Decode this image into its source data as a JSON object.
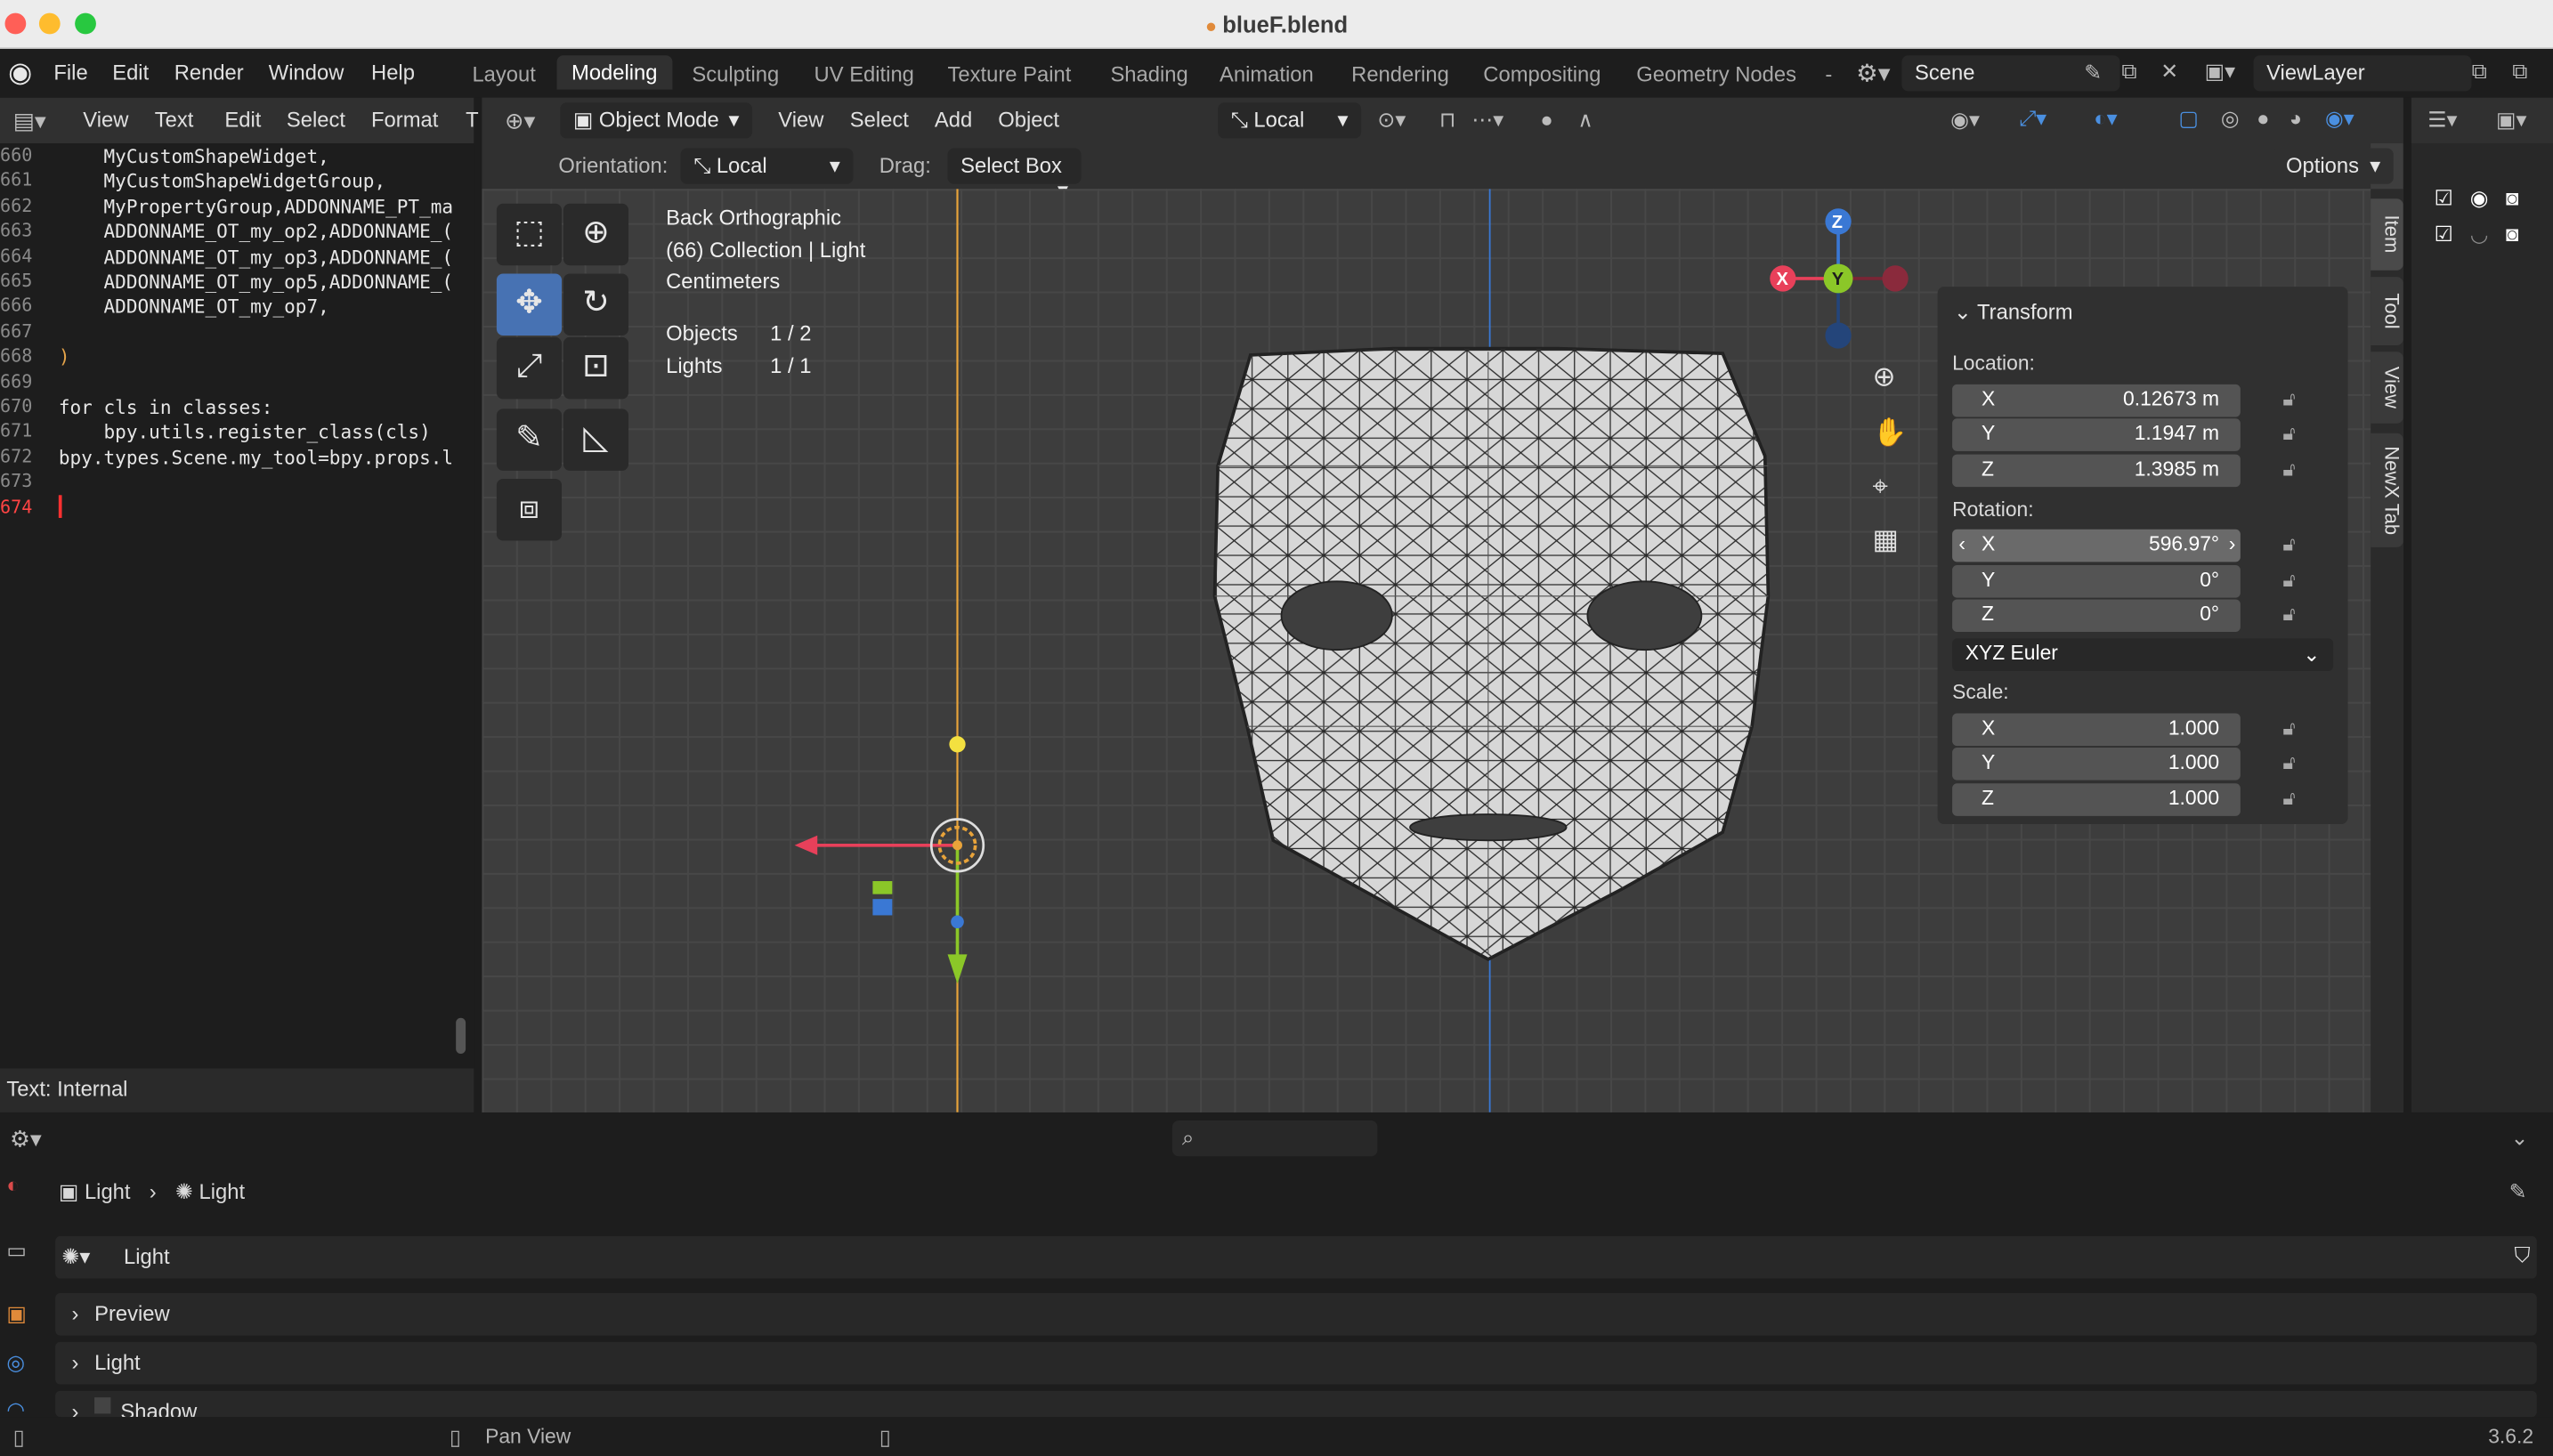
{
  "window": {
    "title": "blueF.blend",
    "file_icon": "blend-file-icon"
  },
  "menu": {
    "items": [
      "File",
      "Edit",
      "Render",
      "Window",
      "Help"
    ]
  },
  "workspaces": {
    "tabs": [
      "Layout",
      "Modeling",
      "Sculpting",
      "UV Editing",
      "Texture Paint",
      "Shading",
      "Animation",
      "Rendering",
      "Compositing",
      "Geometry Nodes"
    ],
    "active": "Modeling",
    "more": "-"
  },
  "scene": {
    "label": "Scene"
  },
  "view_layer": {
    "label": "ViewLayer"
  },
  "text_editor": {
    "menus": [
      "View",
      "Text",
      "Edit",
      "Select",
      "Format",
      "T"
    ],
    "lines": [
      {
        "n": "660",
        "code": "    MyCustomShapeWidget,"
      },
      {
        "n": "661",
        "code": "    MyCustomShapeWidgetGroup,"
      },
      {
        "n": "662",
        "code": "    MyPropertyGroup,ADDONNAME_PT_ma"
      },
      {
        "n": "663",
        "code": "    ADDONNAME_OT_my_op2,ADDONNAME_("
      },
      {
        "n": "664",
        "code": "    ADDONNAME_OT_my_op3,ADDONNAME_("
      },
      {
        "n": "665",
        "code": "    ADDONNAME_OT_my_op5,ADDONNAME_("
      },
      {
        "n": "666",
        "code": "    ADDONNAME_OT_my_op7,"
      },
      {
        "n": "667",
        "code": ""
      },
      {
        "n": "668",
        "code": ")"
      },
      {
        "n": "669",
        "code": ""
      },
      {
        "n": "670",
        "code": "for cls in classes:"
      },
      {
        "n": "671",
        "code": "    bpy.utils.register_class(cls)"
      },
      {
        "n": "672",
        "code": "bpy.types.Scene.my_tool=bpy.props.l"
      },
      {
        "n": "673",
        "code": ""
      },
      {
        "n": "674",
        "code": ""
      }
    ],
    "status": "Text: Internal"
  },
  "viewport": {
    "mode": "Object Mode",
    "menus": [
      "View",
      "Select",
      "Add",
      "Object"
    ],
    "transform_orientation": "Local",
    "orientation_label": "Orientation:",
    "orientation_value": "Local",
    "drag_label": "Drag:",
    "drag_value": "Select Box",
    "options": "Options",
    "overlay": {
      "view": "Back Orthographic",
      "collection": "(66) Collection | Light",
      "units": "Centimeters",
      "objects_label": "Objects",
      "objects_value": "1 / 2",
      "lights_label": "Lights",
      "lights_value": "1 / 1"
    },
    "gizmo": {
      "x": "X",
      "y": "Y",
      "z": "Z"
    }
  },
  "transform": {
    "title": "Transform",
    "location_label": "Location:",
    "location": [
      {
        "axis": "X",
        "value": "0.12673 m"
      },
      {
        "axis": "Y",
        "value": "1.1947 m"
      },
      {
        "axis": "Z",
        "value": "1.3985 m"
      }
    ],
    "rotation_label": "Rotation:",
    "rotation": [
      {
        "axis": "X",
        "value": "596.97°"
      },
      {
        "axis": "Y",
        "value": "0°"
      },
      {
        "axis": "Z",
        "value": "0°"
      }
    ],
    "rotation_mode": "XYZ Euler",
    "scale_label": "Scale:",
    "scale": [
      {
        "axis": "X",
        "value": "1.000"
      },
      {
        "axis": "Y",
        "value": "1.000"
      },
      {
        "axis": "Z",
        "value": "1.000"
      }
    ]
  },
  "sidebar_tabs": [
    "Item",
    "Tool",
    "View",
    "NewX Tab"
  ],
  "properties": {
    "breadcrumb": [
      "Light",
      "Light"
    ],
    "datablock": "Light",
    "panels": [
      "Preview",
      "Light",
      "Shadow"
    ]
  },
  "statusbar": {
    "action": "Pan View",
    "version": "3.6.2"
  },
  "colors": {
    "accent": "#4772b3",
    "x_axis": "#e8405a",
    "y_axis": "#8bc728",
    "z_axis": "#3a78d4",
    "light_line": "#e8a33a"
  }
}
